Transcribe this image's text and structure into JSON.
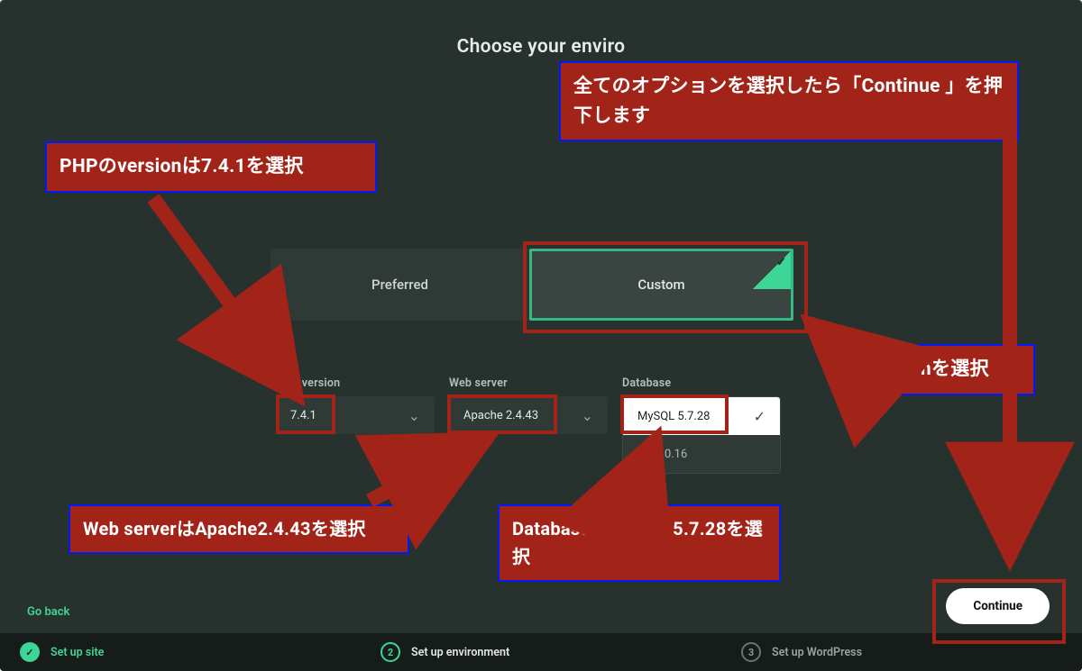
{
  "heading": "Choose your enviro",
  "tabs": {
    "preferred": "Preferred",
    "custom": "Custom"
  },
  "labels": {
    "php": "PHP version",
    "web": "Web server",
    "db": "Database"
  },
  "selects": {
    "php": "7.4.1",
    "web": "Apache 2.4.43",
    "db_selected": "MySQL 5.7.28",
    "db_other": "QL 8.0.16"
  },
  "footer": {
    "goback": "Go back",
    "continue": "Continue"
  },
  "steps": {
    "s1": "Set up site",
    "s2": "Set up environment",
    "s3": "Set up WordPress",
    "n2": "2",
    "n3": "3"
  },
  "callouts": {
    "c1": "全てのオプションを選択したら「Continue 」を押下します",
    "c2": "PHPのversionは7.4.1を選択",
    "c3": "Customを選択",
    "c4": "Web serverはApache2.4.43を選択",
    "c5": "DatabaseはMySQL 5.7.28を選択"
  }
}
